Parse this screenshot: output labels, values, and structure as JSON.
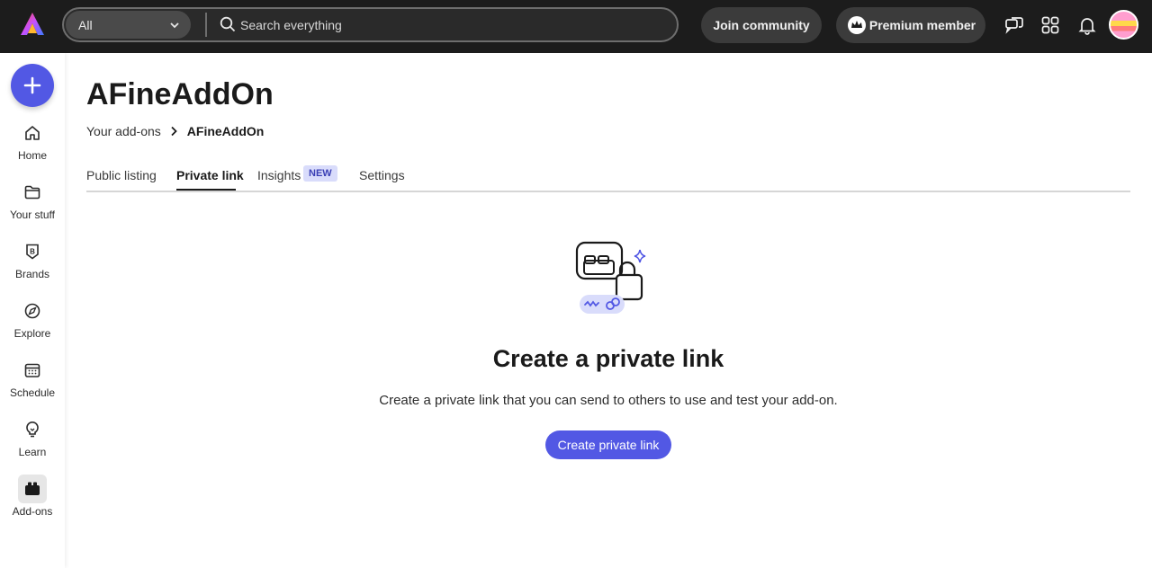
{
  "topbar": {
    "scope_value": "All",
    "search_placeholder": "Search everything",
    "join_label": "Join community",
    "premium_label": "Premium member"
  },
  "rail": {
    "create_icon": "plus-icon",
    "items": [
      {
        "label": "Home",
        "icon": "home-icon"
      },
      {
        "label": "Your stuff",
        "icon": "folder-icon"
      },
      {
        "label": "Brands",
        "icon": "brand-icon"
      },
      {
        "label": "Explore",
        "icon": "compass-icon"
      },
      {
        "label": "Schedule",
        "icon": "calendar-icon"
      },
      {
        "label": "Learn",
        "icon": "lightbulb-icon"
      },
      {
        "label": "Add-ons",
        "icon": "addons-icon"
      }
    ]
  },
  "main": {
    "title": "AFineAddOn",
    "breadcrumb": {
      "parent": "Your add-ons",
      "current": "AFineAddOn"
    },
    "tabs": [
      {
        "label": "Public listing"
      },
      {
        "label": "Private link"
      },
      {
        "label": "Insights",
        "badge": "NEW"
      },
      {
        "label": "Settings"
      }
    ],
    "empty_state": {
      "title": "Create a private link",
      "description": "Create a private link that you can send to others to use and test your add-on.",
      "button_label": "Create private link"
    }
  },
  "colors": {
    "accent": "#5258e4",
    "topbar_bg": "#1c1c1c",
    "badge_bg": "#d9dcfb"
  }
}
